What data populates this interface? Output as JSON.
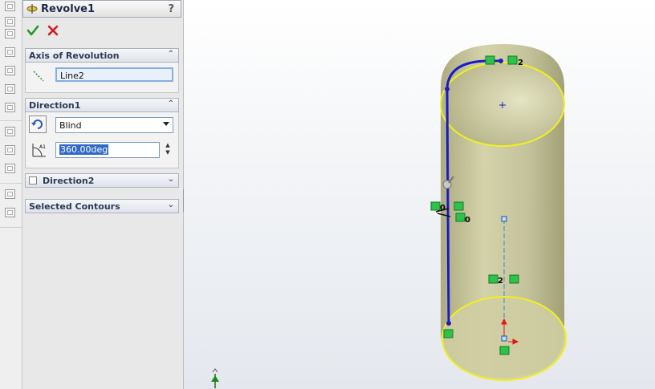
{
  "property_manager": {
    "title": "Revolve1",
    "help_label": "?",
    "ok_icon": "checkmark-icon",
    "cancel_icon": "x-icon",
    "axis_of_revolution": {
      "header": "Axis of Revolution",
      "value": "Line2"
    },
    "direction1": {
      "header": "Direction1",
      "end_condition": "Blind",
      "angle": "360.00deg"
    },
    "direction2": {
      "header": "Direction2",
      "checked": false
    },
    "selected_contours": {
      "header": "Selected Contours"
    }
  },
  "sketch_relations": {
    "top_tag": "2",
    "left_tag": "0",
    "left_tag2": "0",
    "mid_tag": "2"
  },
  "colors": {
    "sketch_line": "#1a1acb",
    "preview_fill": "#c9c79a",
    "edge_yellow": "#f0f020",
    "relation_green": "#2ec24a",
    "ok_green": "#1e9d22",
    "cancel_red": "#d21b1b"
  }
}
